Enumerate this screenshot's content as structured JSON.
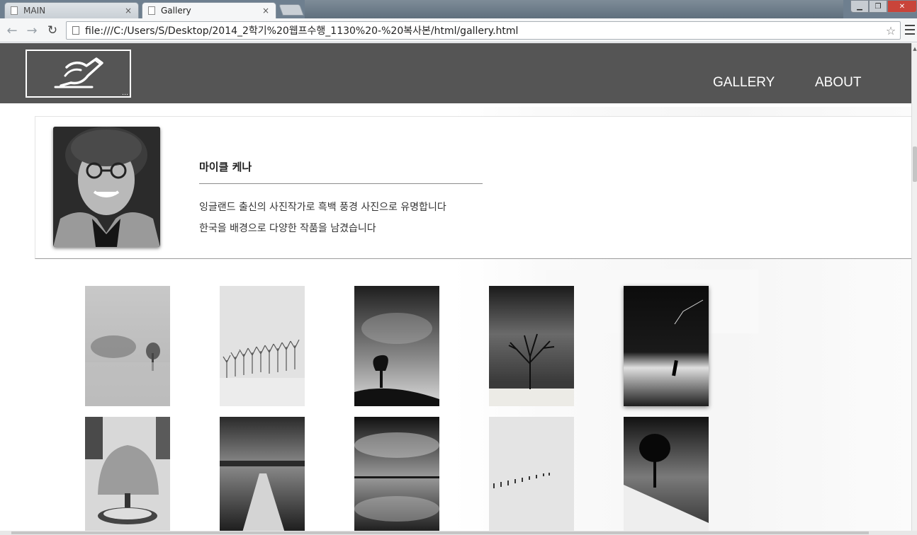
{
  "browser": {
    "tabs": [
      {
        "label": "MAIN",
        "active": false
      },
      {
        "label": "Gallery",
        "active": true
      }
    ],
    "close_glyph": "×",
    "url": "file:///C:/Users/S/Desktop/2014_2학기%20웹프수행_1130%20-%20복사본/html/gallery.html",
    "window_controls": {
      "minimize": "▁",
      "maximize": "❐",
      "close": "✕"
    }
  },
  "site": {
    "nav": {
      "gallery": "GALLERY",
      "about": "ABOUT"
    },
    "logo_icon": "pen-writing-icon"
  },
  "profile": {
    "name": "마이클 케나",
    "bio_line1": "잉글랜드 출신의 사진작가로 흑백 풍경 사진으로 유명합니다",
    "bio_line2": "한국을 배경으로 다양한 작품을 남겼습니다"
  },
  "gallery": {
    "rows": 2,
    "columns": 5,
    "images": [
      "misty-trees-photo",
      "snow-tree-row-photo",
      "windswept-tree-photo",
      "bare-tree-snow-photo",
      "post-in-water-photo",
      "snow-covered-tree-photo",
      "pier-lake-photo",
      "cloud-reflection-photo",
      "fence-in-snow-photo",
      "pine-tree-hill-photo"
    ]
  }
}
